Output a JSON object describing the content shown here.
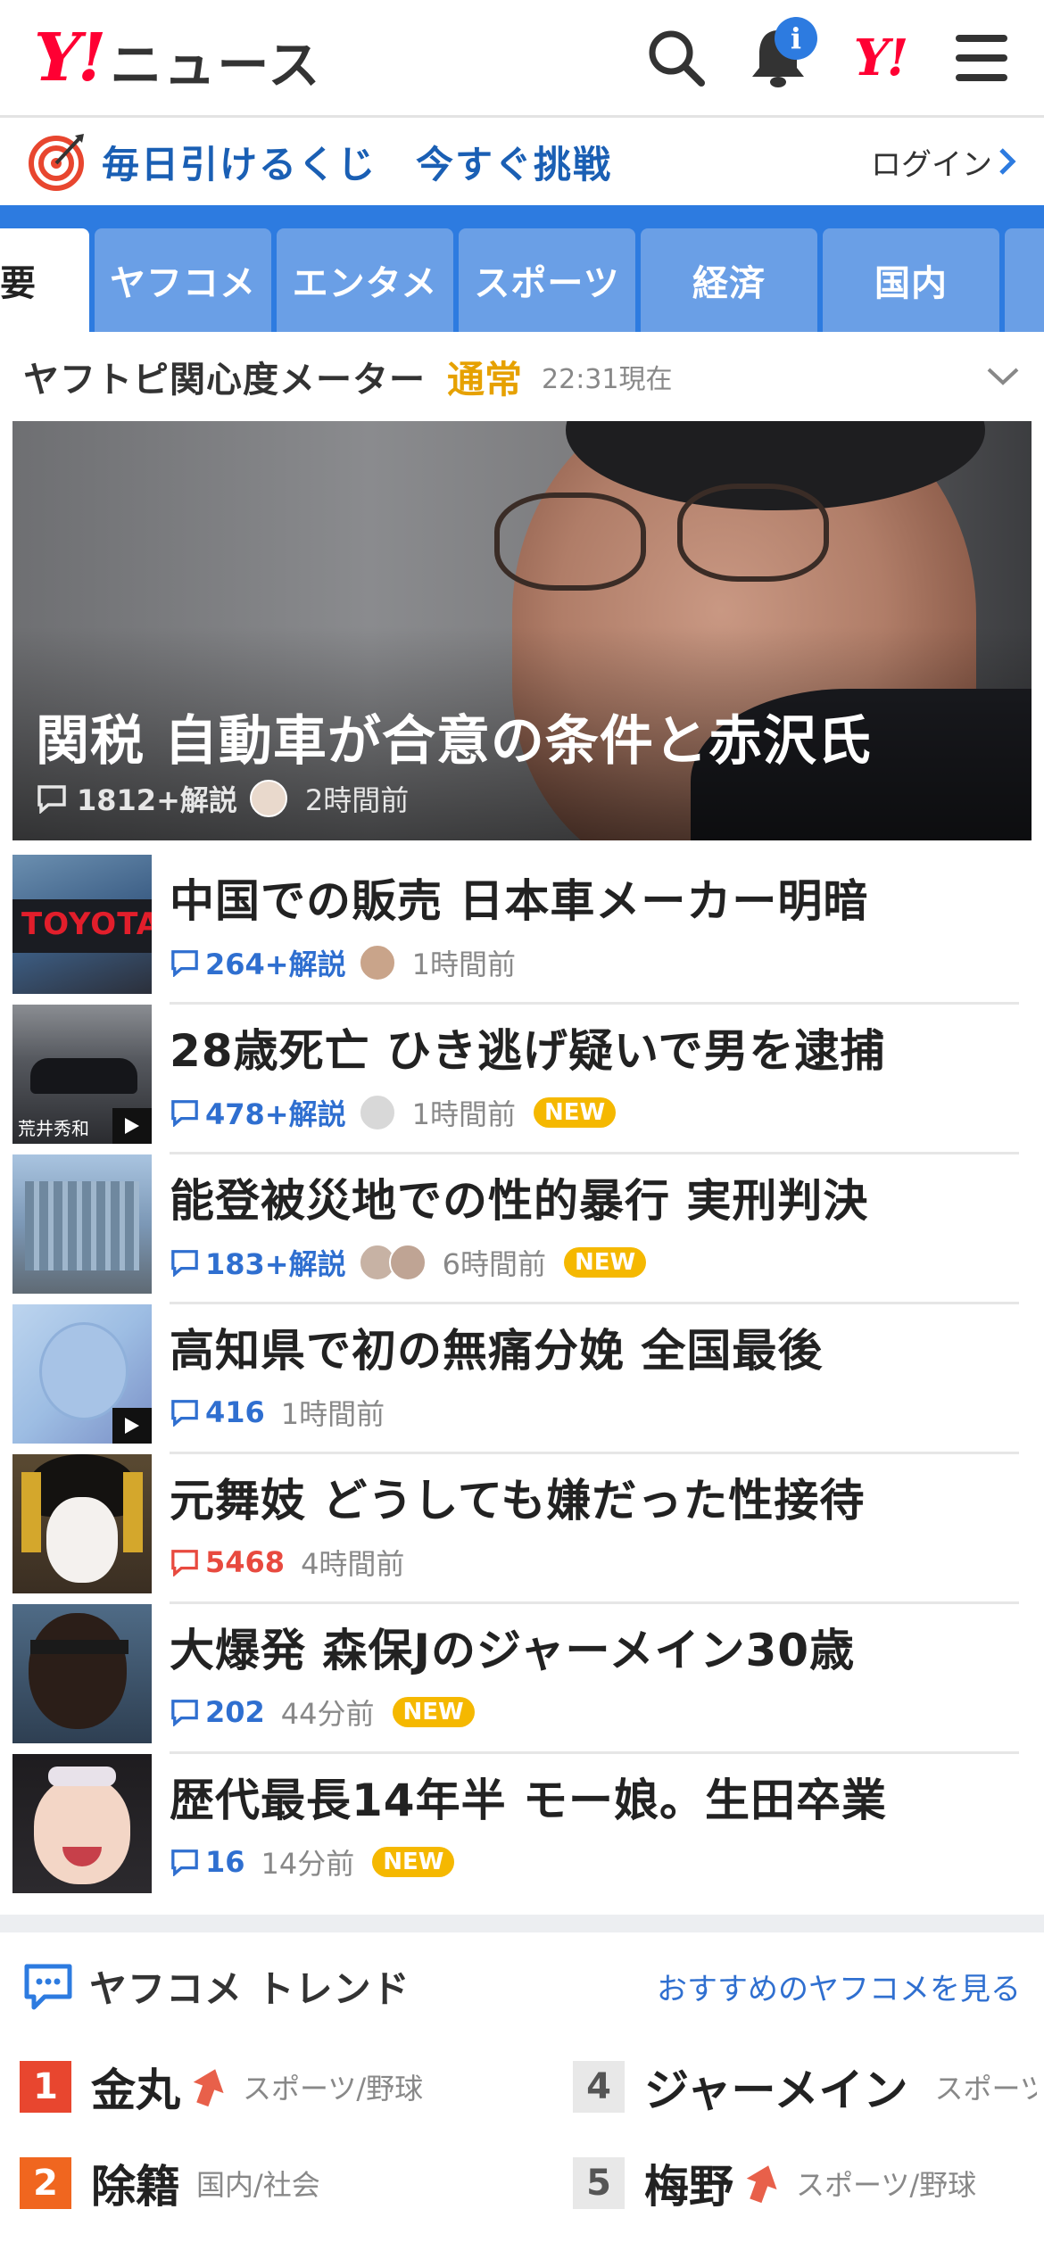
{
  "header": {
    "logo_mark": "Y!",
    "logo_text": "ニュース",
    "notification_badge": "i",
    "brand_mark": "Y!"
  },
  "lottery": {
    "text": "毎日引けるくじ　今すぐ挑戦",
    "login_label": "ログイン"
  },
  "tabs": [
    {
      "label": "要",
      "active": true
    },
    {
      "label": "ヤフコメ"
    },
    {
      "label": "エンタメ"
    },
    {
      "label": "スポーツ"
    },
    {
      "label": "経済"
    },
    {
      "label": "国内"
    }
  ],
  "meter": {
    "title": "ヤフトピ関心度メーター",
    "status": "通常",
    "time": "22:31現在"
  },
  "hero": {
    "title": "関税 自動車が合意の条件と赤沢氏",
    "comment_count": "1812+解説",
    "time": "2時間前"
  },
  "news": [
    {
      "title": "中国での販売 日本車メーカー明暗",
      "comments": "264+解説",
      "time": "1時間前",
      "new": false,
      "hot": false
    },
    {
      "title": "28歳死亡 ひき逃げ疑いで男を逮捕",
      "comments": "478+解説",
      "time": "1時間前",
      "new": true,
      "hot": false
    },
    {
      "title": "能登被災地での性的暴行 実刑判決",
      "comments": "183+解説",
      "time": "6時間前",
      "new": true,
      "hot": false
    },
    {
      "title": "高知県で初の無痛分娩 全国最後",
      "comments": "416",
      "time": "1時間前",
      "new": false,
      "hot": false
    },
    {
      "title": "元舞妓 どうしても嫌だった性接待",
      "comments": "5468",
      "time": "4時間前",
      "new": false,
      "hot": true
    },
    {
      "title": "大爆発 森保Jのジャーメイン30歳",
      "comments": "202",
      "time": "44分前",
      "new": true,
      "hot": false
    },
    {
      "title": "歴代最長14年半 モー娘。生田卒業",
      "comments": "16",
      "time": "14分前",
      "new": true,
      "hot": false
    }
  ],
  "new_label": "NEW",
  "thumb_text": {
    "toyota": "TOYOTA",
    "caption": "荒井秀和"
  },
  "trend": {
    "title": "ヤフコメ トレンド",
    "link": "おすすめのヤフコメを見る",
    "items": [
      {
        "rank": "1",
        "word": "金丸",
        "category": "スポーツ/野球"
      },
      {
        "rank": "4",
        "word": "ジャーメイン",
        "category": "スポーツ/サッカー"
      },
      {
        "rank": "2",
        "word": "除籍",
        "category": "国内/社会"
      },
      {
        "rank": "5",
        "word": "梅野",
        "category": "スポーツ/野球"
      }
    ]
  },
  "colors": {
    "brand_red": "#ff0033",
    "accent_blue": "#2d7be0",
    "new_badge": "#f5b800",
    "hot_comment": "#e84a3f"
  }
}
